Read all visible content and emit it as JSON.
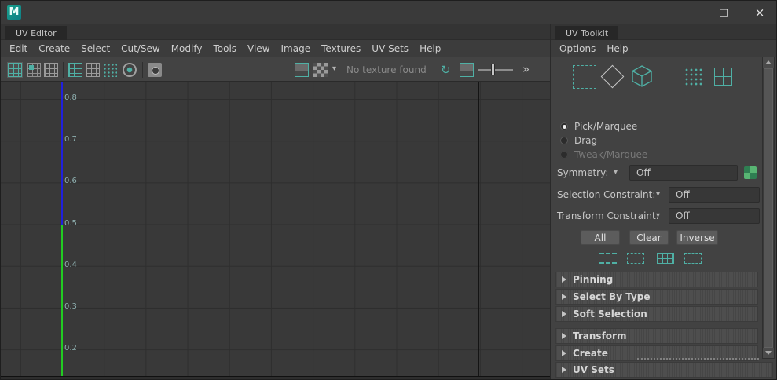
{
  "titlebar": {
    "app_initial": "M",
    "controls": {
      "minimize": "–",
      "maximize": "□",
      "close": "×"
    }
  },
  "editor": {
    "tab": "UV Editor",
    "menus": [
      "Edit",
      "Create",
      "Select",
      "Cut/Sew",
      "Modify",
      "Tools",
      "View",
      "Image",
      "Textures",
      "UV Sets",
      "Help"
    ],
    "toolbar": {
      "texture_status": "No texture found",
      "dropdown_caret": "▾",
      "expand": "»"
    },
    "grid": {
      "labels": [
        "0.8",
        "0.7",
        "0.6",
        "0.5",
        "0.4",
        "0.3",
        "0.2"
      ]
    }
  },
  "toolkit": {
    "tab": "UV Toolkit",
    "menus": [
      "Options",
      "Help"
    ],
    "radios": [
      {
        "label": "Pick/Marquee",
        "state": "selected"
      },
      {
        "label": "Drag",
        "state": "unselected"
      },
      {
        "label": "Tweak/Marquee",
        "state": "disabled"
      }
    ],
    "symmetry": {
      "label": "Symmetry:",
      "value": "Off",
      "caret": "▾"
    },
    "selection_constraint": {
      "label": "Selection Constraint:",
      "value": "Off",
      "caret": "▾"
    },
    "transform_constraint": {
      "label": "Transform Constraint:",
      "value": "Off",
      "caret": "▾"
    },
    "buttons": [
      "All",
      "Clear",
      "Inverse"
    ],
    "sections": [
      "Pinning",
      "Select By Type",
      "Soft Selection",
      "Transform",
      "Create",
      "UV Sets"
    ]
  },
  "colors": {
    "accent_teal": "#4fb0a5",
    "axis_blue": "#2020dd",
    "axis_green": "#22cc22",
    "background": "#3c3c3c"
  }
}
